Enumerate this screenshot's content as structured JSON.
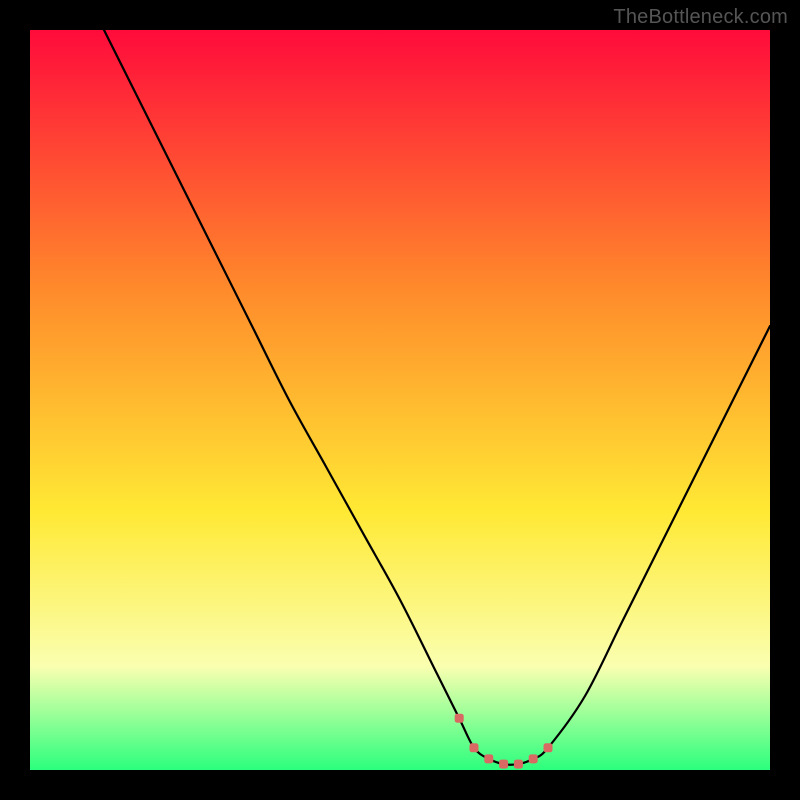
{
  "watermark": "TheBottleneck.com",
  "colors": {
    "gradient_top": "#ff0b3b",
    "gradient_mid1": "#ff8a2b",
    "gradient_mid2": "#ffe934",
    "gradient_low": "#faffb0",
    "gradient_bottom": "#2bff7d",
    "curve": "#000000",
    "marker": "#d86a63"
  },
  "chart_data": {
    "type": "line",
    "title": "",
    "xlabel": "",
    "ylabel": "",
    "xlim": [
      0,
      100
    ],
    "ylim": [
      0,
      100
    ],
    "series": [
      {
        "name": "curve",
        "x": [
          10,
          15,
          20,
          25,
          30,
          35,
          40,
          45,
          50,
          55,
          58,
          60,
          62,
          64,
          66,
          68,
          70,
          75,
          80,
          85,
          90,
          95,
          100
        ],
        "y": [
          100,
          90,
          80,
          70,
          60,
          50,
          41,
          32,
          23,
          13,
          7,
          3,
          1.5,
          0.8,
          0.8,
          1.5,
          3,
          10,
          20,
          30,
          40,
          50,
          60
        ]
      },
      {
        "name": "sweet-spot-markers",
        "x": [
          58,
          60,
          62,
          64,
          66,
          68,
          70
        ],
        "y": [
          7,
          3,
          1.5,
          0.8,
          0.8,
          1.5,
          3
        ]
      }
    ],
    "gradient_stops": [
      {
        "offset": 0.0,
        "color": "#ff0b3b"
      },
      {
        "offset": 0.35,
        "color": "#ff8a2b"
      },
      {
        "offset": 0.65,
        "color": "#ffe934"
      },
      {
        "offset": 0.86,
        "color": "#faffb0"
      },
      {
        "offset": 1.0,
        "color": "#2bff7d"
      }
    ]
  }
}
